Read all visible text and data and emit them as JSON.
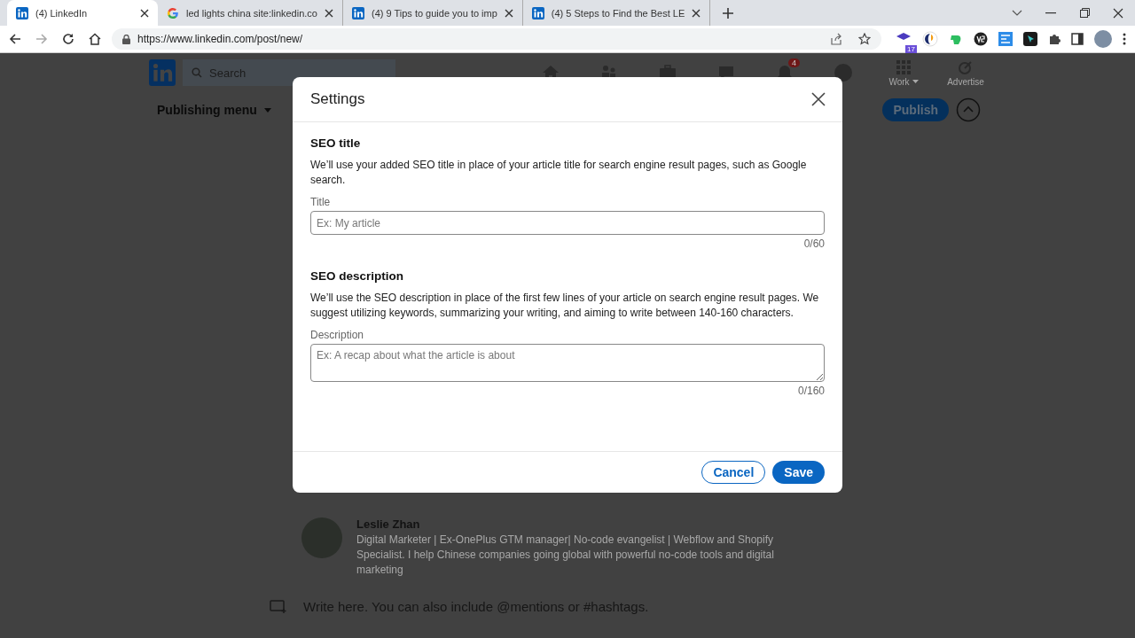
{
  "browser": {
    "tabs": [
      {
        "kind": "linkedin",
        "title": "(4) LinkedIn",
        "selected": true
      },
      {
        "kind": "google",
        "title": "led lights china site:linkedin.co",
        "selected": false
      },
      {
        "kind": "linkedin",
        "title": "(4) 9 Tips to guide you to imp",
        "selected": false
      },
      {
        "kind": "linkedin",
        "title": "(4) 5 Steps to Find the Best LE",
        "selected": false
      }
    ],
    "url": "https://www.linkedin.com/post/new/",
    "extension_badge": "17"
  },
  "header": {
    "search": {
      "placeholder": "Search"
    },
    "notification_count": "4",
    "work_label": "Work",
    "advertise_label": "Advertise"
  },
  "toolbar": {
    "publishing_menu": "Publishing menu",
    "publish": "Publish"
  },
  "author": {
    "name": "Leslie Zhan",
    "headline": "Digital Marketer | Ex-OnePlus GTM manager| No-code evangelist | Webflow and Shopify Specialist. I help Chinese companies going global with powerful no-code tools and digital marketing"
  },
  "editor": {
    "placeholder": "Write here. You can also include @mentions or #hashtags."
  },
  "modal": {
    "title": "Settings",
    "sections": [
      {
        "kind": "input",
        "heading": "SEO title",
        "description": "We’ll use your added SEO title in place of your article title for search engine result pages, such as Google search.",
        "field_label": "Title",
        "placeholder": "Ex: My article",
        "counter": "0/60"
      },
      {
        "kind": "textarea",
        "heading": "SEO description",
        "description": "We’ll use the SEO description in place of the first few lines of your article on search engine result pages. We suggest utilizing keywords, summarizing your writing, and aiming to write between 140-160 characters.",
        "field_label": "Description",
        "placeholder": "Ex: A recap about what the article is about",
        "counter": "0/160"
      }
    ],
    "cancel": "Cancel",
    "save": "Save"
  }
}
